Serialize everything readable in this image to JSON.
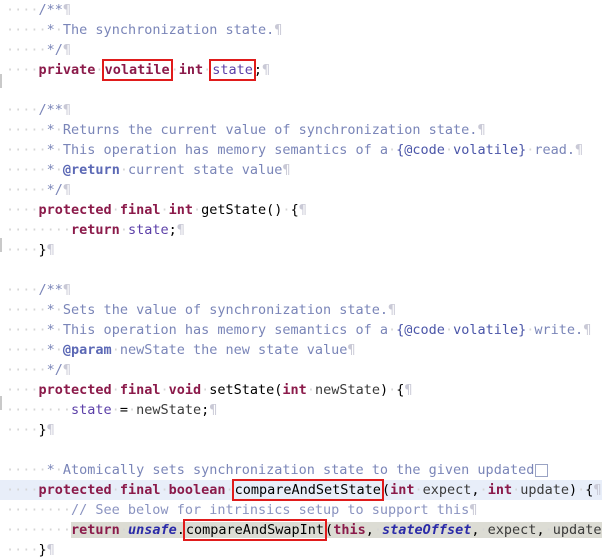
{
  "app": {
    "kind": "code-editor",
    "language": "Java",
    "theme": "light",
    "colors": {
      "background": "#ffffff",
      "keyword": "#8b1a4a",
      "comment": "#7a85b8",
      "field": "#5b3fa8",
      "variable": "#2a2aa8",
      "annotation_box": "#e01b1b",
      "current_line": "#e8eef9",
      "usage_highlight": "#dcdcd4",
      "whitespace_dot": "#d5d5d5"
    }
  },
  "annotations": {
    "boxes": [
      "volatile",
      "state",
      "compareAndSetState",
      "compareAndSwapInt"
    ]
  },
  "code": {
    "lines": [
      {
        "id": "l1",
        "indent": 4,
        "text": "/**",
        "type": "javadoc-open"
      },
      {
        "id": "l2",
        "indent": 5,
        "text": "* The synchronization state.",
        "type": "javadoc"
      },
      {
        "id": "l3",
        "indent": 5,
        "text": "*/",
        "type": "javadoc-close"
      },
      {
        "id": "l4",
        "indent": 4,
        "text": "private volatile int state;",
        "type": "code"
      },
      {
        "id": "l5",
        "indent": 0,
        "text": "",
        "type": "blank"
      },
      {
        "id": "l6",
        "indent": 4,
        "text": "/**",
        "type": "javadoc-open"
      },
      {
        "id": "l7",
        "indent": 5,
        "text": "* Returns the current value of synchronization state.",
        "type": "javadoc"
      },
      {
        "id": "l8",
        "indent": 5,
        "text": "* This operation has memory semantics of a {@code volatile} read.",
        "type": "javadoc"
      },
      {
        "id": "l9",
        "indent": 5,
        "text": "* @return current state value",
        "type": "javadoc"
      },
      {
        "id": "l10",
        "indent": 5,
        "text": "*/",
        "type": "javadoc-close"
      },
      {
        "id": "l11",
        "indent": 4,
        "text": "protected final int getState() {",
        "type": "code"
      },
      {
        "id": "l12",
        "indent": 8,
        "text": "return state;",
        "type": "code"
      },
      {
        "id": "l13",
        "indent": 4,
        "text": "}",
        "type": "code"
      },
      {
        "id": "l14",
        "indent": 0,
        "text": "",
        "type": "blank"
      },
      {
        "id": "l15",
        "indent": 4,
        "text": "/**",
        "type": "javadoc-open"
      },
      {
        "id": "l16",
        "indent": 5,
        "text": "* Sets the value of synchronization state.",
        "type": "javadoc"
      },
      {
        "id": "l17",
        "indent": 5,
        "text": "* This operation has memory semantics of a {@code volatile} write.",
        "type": "javadoc"
      },
      {
        "id": "l18",
        "indent": 5,
        "text": "* @param newState the new state value",
        "type": "javadoc"
      },
      {
        "id": "l19",
        "indent": 5,
        "text": "*/",
        "type": "javadoc-close"
      },
      {
        "id": "l20",
        "indent": 4,
        "text": "protected final void setState(int newState) {",
        "type": "code"
      },
      {
        "id": "l21",
        "indent": 8,
        "text": "state = newState;",
        "type": "code"
      },
      {
        "id": "l22",
        "indent": 4,
        "text": "}",
        "type": "code"
      },
      {
        "id": "l23",
        "indent": 0,
        "text": "",
        "type": "blank"
      },
      {
        "id": "l24",
        "indent": 5,
        "text": "* Atomically sets synchronization state to the given updated",
        "type": "javadoc-folded"
      },
      {
        "id": "l25",
        "indent": 4,
        "text": "protected final boolean compareAndSetState(int expect, int update) {",
        "type": "code"
      },
      {
        "id": "l26",
        "indent": 8,
        "text": "// See below for intrinsics setup to support this",
        "type": "line-comment"
      },
      {
        "id": "l27",
        "indent": 8,
        "text": "return unsafe.compareAndSwapInt(this, stateOffset, expect, update);",
        "type": "code"
      },
      {
        "id": "l28",
        "indent": 4,
        "text": "}",
        "type": "code"
      }
    ],
    "tokens": {
      "javadoc_open": "/**",
      "javadoc_close": "*/",
      "star": "*",
      "pilcrow": "¶",
      "dot": "·",
      "kw_private": "private",
      "kw_volatile": "volatile",
      "kw_int": "int",
      "kw_protected": "protected",
      "kw_final": "final",
      "kw_void": "void",
      "kw_boolean": "boolean",
      "kw_return": "return",
      "kw_this": "this",
      "field_state": "state",
      "method_getState": "getState",
      "method_setState": "setState",
      "method_compareAndSetState": "compareAndSetState",
      "method_compareAndSwapInt": "compareAndSwapInt",
      "var_unsafe": "unsafe",
      "var_stateOffset": "stateOffset",
      "param_newState": "newState",
      "param_expect": "expect",
      "param_update": "update",
      "tag_return": "@return",
      "tag_param": "@param",
      "tag_code": "{@code",
      "brace_close": "}",
      "text_the_sync_state": "The synchronization state.",
      "text_returns": "Returns the current value of synchronization state.",
      "text_memsem_read": "This operation has memory semantics of a",
      "text_read_end": "read.",
      "text_write_end": "write.",
      "text_return_doc": "current state value",
      "text_sets": "Sets the value of synchronization state.",
      "text_param_doc": "newState the new state value",
      "text_atomically": "Atomically sets synchronization state to the given updated",
      "text_see_below": "// See below for intrinsics setup to support this"
    }
  }
}
